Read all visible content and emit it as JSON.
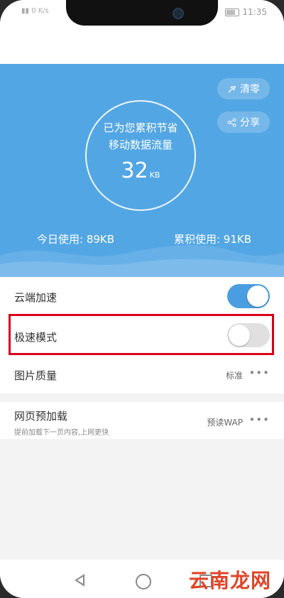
{
  "status_bar": {
    "left_text": "0 K/s",
    "time": "11:35"
  },
  "hero": {
    "line1": "已为您累积节省",
    "line2": "移动数据流量",
    "saved_value": "32",
    "saved_unit": "KB",
    "clean_label": "清零",
    "share_label": "分享",
    "today_usage": "今日使用: 89KB",
    "total_usage": "累积使用: 91KB",
    "background_color": "#53a6e4"
  },
  "settings": {
    "cloud_accel": {
      "label": "云端加速",
      "enabled": true
    },
    "speed_mode": {
      "label": "极速模式",
      "enabled": false
    },
    "image_quality": {
      "label": "图片质量",
      "value": "标准"
    },
    "preload": {
      "label": "网页预加载",
      "desc": "提前加载下一页内容,上网更快",
      "value": "预读WAP"
    }
  },
  "highlight_color": "#d9001b",
  "watermark": "云南龙网"
}
